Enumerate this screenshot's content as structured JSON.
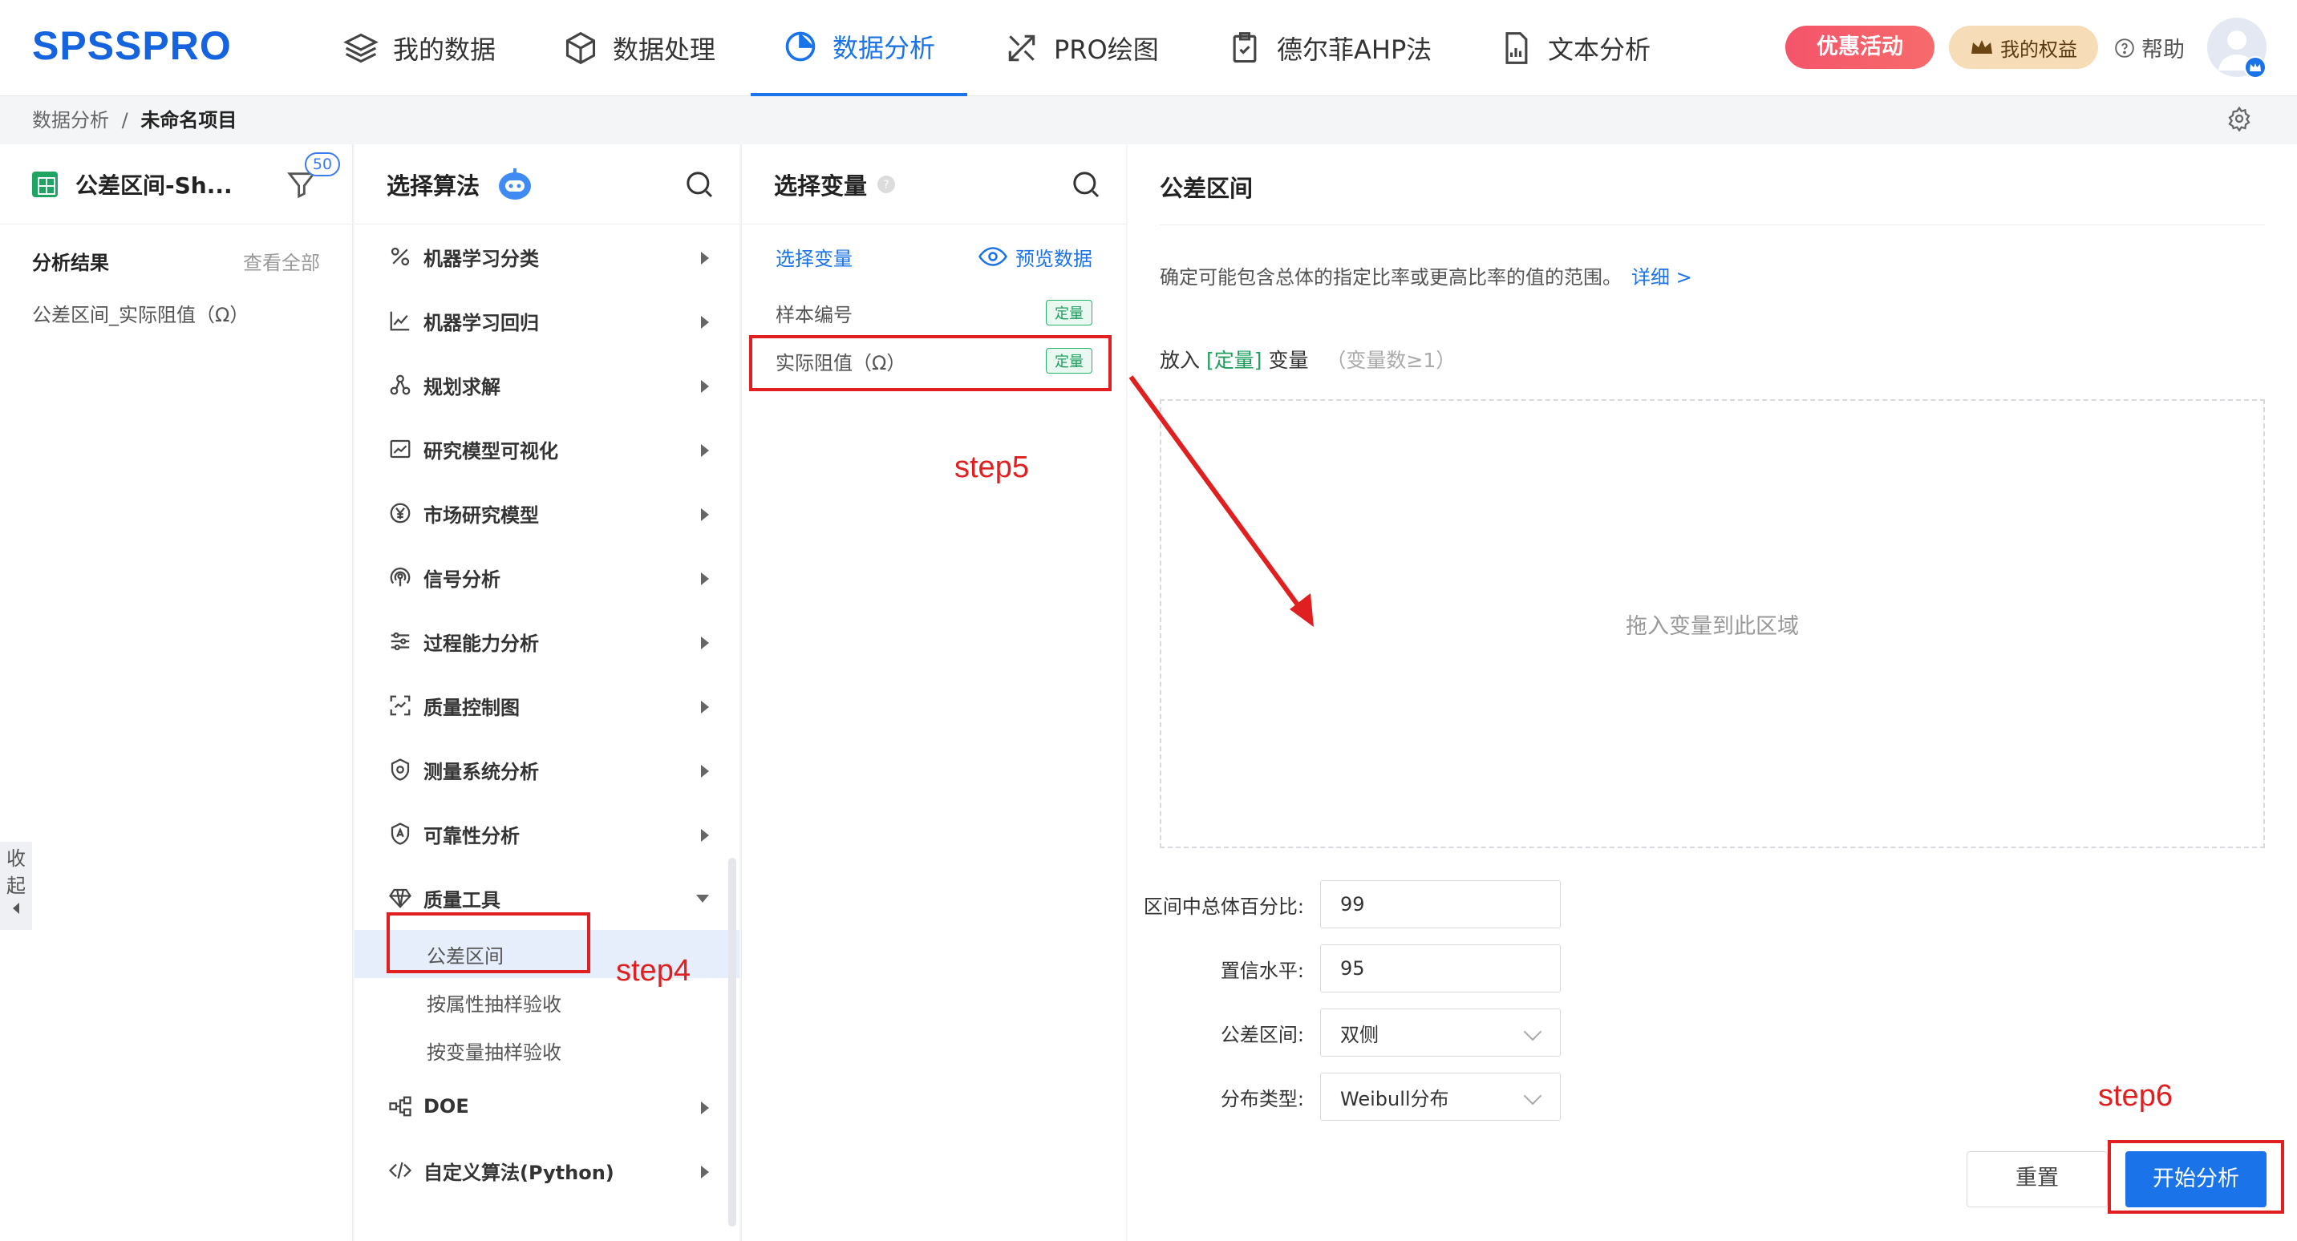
{
  "app": {
    "logo": "SPSSPRO"
  },
  "nav": [
    {
      "label": "我的数据",
      "icon": "layers-icon"
    },
    {
      "label": "数据处理",
      "icon": "cube-icon"
    },
    {
      "label": "数据分析",
      "icon": "pie-chart-icon",
      "active": true
    },
    {
      "label": "PRO绘图",
      "icon": "draw-tools-icon"
    },
    {
      "label": "德尔菲AHP法",
      "icon": "clipboard-check-icon"
    },
    {
      "label": "文本分析",
      "icon": "document-chart-icon"
    }
  ],
  "header": {
    "promo": "优惠活动",
    "rights": "我的权益",
    "help": "帮助"
  },
  "breadcrumb": {
    "root": "数据分析",
    "sep": "/",
    "current": "未命名项目"
  },
  "left": {
    "file_title": "公差区间-Sh...",
    "filter_badge": "50",
    "results_title": "分析结果",
    "view_all": "查看全部",
    "result_item": "公差区间_实际阻值（Ω）",
    "collapse": [
      "收",
      "起"
    ]
  },
  "algorithms": {
    "title": "选择算法",
    "items": [
      {
        "label": "机器学习分类",
        "icon": "percent-icon"
      },
      {
        "label": "机器学习回归",
        "icon": "line-chart-icon"
      },
      {
        "label": "规划求解",
        "icon": "route-icon"
      },
      {
        "label": "研究模型可视化",
        "icon": "area-chart-icon"
      },
      {
        "label": "市场研究模型",
        "icon": "yen-circle-icon"
      },
      {
        "label": "信号分析",
        "icon": "signal-icon"
      },
      {
        "label": "过程能力分析",
        "icon": "sliders-icon"
      },
      {
        "label": "质量控制图",
        "icon": "scan-icon"
      },
      {
        "label": "测量系统分析",
        "icon": "shield-gauge-icon"
      },
      {
        "label": "可靠性分析",
        "icon": "shield-a-icon"
      },
      {
        "label": "质量工具",
        "icon": "diamond-icon"
      }
    ],
    "sub_items": [
      "公差区间",
      "按属性抽样验收",
      "按变量抽样验收"
    ],
    "after_items": [
      {
        "label": "DOE",
        "icon": "flow-icon"
      },
      {
        "label": "自定义算法(Python)",
        "icon": "code-icon"
      }
    ]
  },
  "variables": {
    "title": "选择变量",
    "select_label": "选择变量",
    "preview_label": "预览数据",
    "items": [
      {
        "name": "样本编号",
        "tag": "定量"
      },
      {
        "name": "实际阻值（Ω）",
        "tag": "定量"
      }
    ]
  },
  "config": {
    "title": "公差区间",
    "description": "确定可能包含总体的指定比率或更高比率的值的范围。",
    "detail_link": "详细 >",
    "place_prefix": "放入",
    "place_type": "[定量]",
    "place_suffix": "变量",
    "place_hint": "（变量数≥1）",
    "drop_hint": "拖入变量到此区域",
    "fields": [
      {
        "label": "区间中总体百分比:",
        "value": "99",
        "type": "input"
      },
      {
        "label": "置信水平:",
        "value": "95",
        "type": "input"
      },
      {
        "label": "公差区间:",
        "value": "双侧",
        "type": "select"
      },
      {
        "label": "分布类型:",
        "value": "Weibull分布",
        "type": "select"
      }
    ],
    "reset_label": "重置",
    "start_label": "开始分析"
  },
  "annotations": {
    "step4": "step4",
    "step5": "step5",
    "step6": "step6"
  },
  "colors": {
    "brand": "#1a73e8",
    "annotation": "#e02020",
    "quant_tag": "#1d9e5c"
  }
}
